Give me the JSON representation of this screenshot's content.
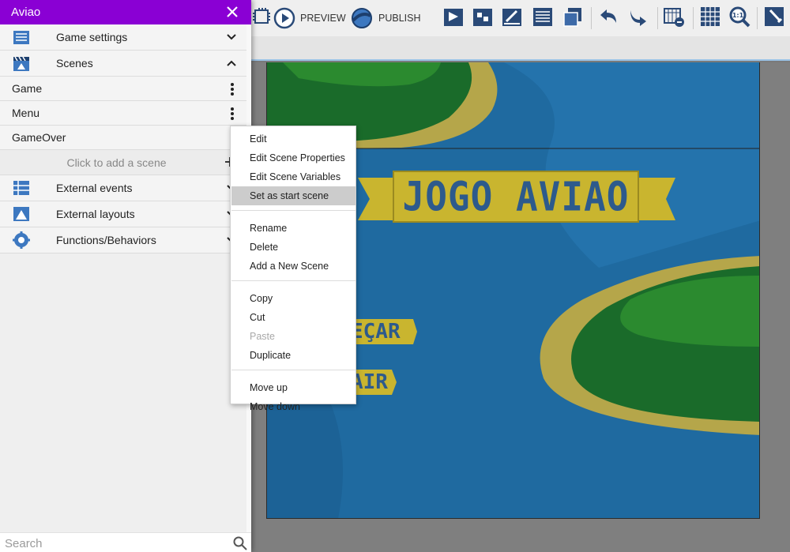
{
  "project": {
    "title": "Aviao"
  },
  "toolbar": {
    "preview_label": "PREVIEW",
    "publish_label": "PUBLISH",
    "icons": [
      "scene-events-icon",
      "preview-icon",
      "publish-icon",
      "open-objects-icon",
      "object-groups-icon",
      "properties-icon",
      "layers-icon",
      "instances-list-icon",
      "undo-icon",
      "redo-icon",
      "window-mask-icon",
      "grid-icon",
      "zoom-reset-icon",
      "settings-icon"
    ]
  },
  "drawer": {
    "sections": {
      "game_settings": "Game settings",
      "scenes": "Scenes",
      "external_events": "External events",
      "external_layouts": "External layouts",
      "functions": "Functions/Behaviors"
    },
    "scenes": [
      {
        "label": "Game"
      },
      {
        "label": "Menu"
      },
      {
        "label": "GameOver"
      }
    ],
    "add_scene": "Click to add a scene",
    "search_placeholder": "Search"
  },
  "scene_preview": {
    "banner_text": "JOGO AVIAO",
    "button1_text": "EÇAR",
    "button2_text": "AIR",
    "colors": {
      "water": "#1f6aa0",
      "sand": "#b5a64a",
      "grass": "#1a6b2a",
      "grass_light": "#2b8a2f",
      "banner": "#c9b52f",
      "banner_text": "#2d5a8c"
    }
  },
  "context_menu": {
    "groups": [
      [
        {
          "label": "Edit",
          "enabled": true,
          "highlighted": false
        },
        {
          "label": "Edit Scene Properties",
          "enabled": true,
          "highlighted": false
        },
        {
          "label": "Edit Scene Variables",
          "enabled": true,
          "highlighted": false
        },
        {
          "label": "Set as start scene",
          "enabled": true,
          "highlighted": true
        }
      ],
      [
        {
          "label": "Rename",
          "enabled": true,
          "highlighted": false
        },
        {
          "label": "Delete",
          "enabled": true,
          "highlighted": false
        },
        {
          "label": "Add a New Scene",
          "enabled": true,
          "highlighted": false
        }
      ],
      [
        {
          "label": "Copy",
          "enabled": true,
          "highlighted": false
        },
        {
          "label": "Cut",
          "enabled": true,
          "highlighted": false
        },
        {
          "label": "Paste",
          "enabled": false,
          "highlighted": false
        },
        {
          "label": "Duplicate",
          "enabled": true,
          "highlighted": false
        }
      ],
      [
        {
          "label": "Move up",
          "enabled": true,
          "highlighted": false
        },
        {
          "label": "Move down",
          "enabled": true,
          "highlighted": false
        }
      ]
    ]
  },
  "colors": {
    "accent": "#8a00d4",
    "highlight": "#cccccc"
  }
}
